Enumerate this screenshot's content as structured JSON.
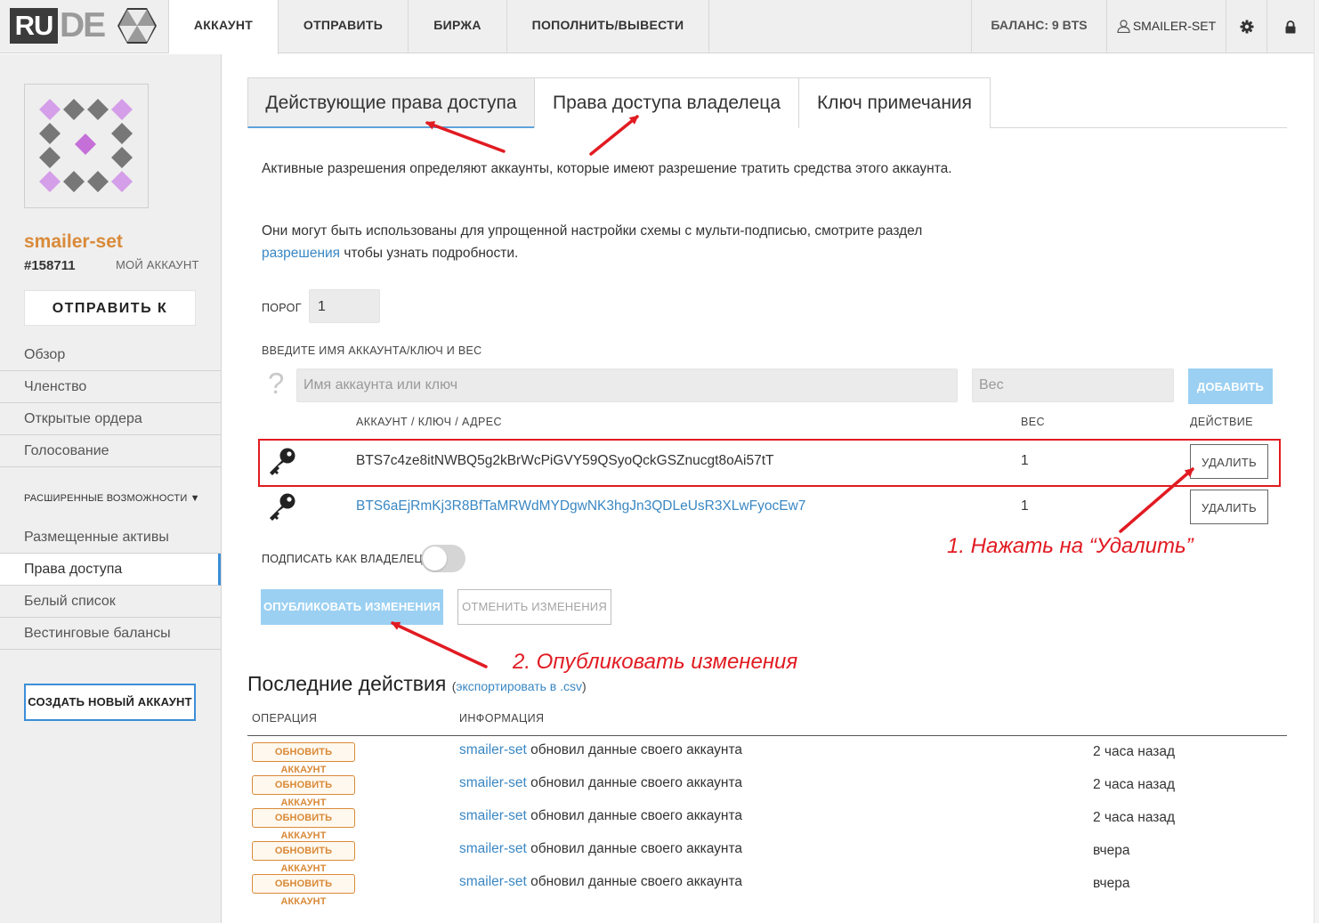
{
  "logo": {
    "part1": "RU",
    "part2": "DE"
  },
  "nav": [
    "АККАУНТ",
    "ОТПРАВИТЬ",
    "БИРЖА",
    "ПОПОЛНИТЬ/ВЫВЕСТИ"
  ],
  "header": {
    "balance": "БАЛАНС: 9 BTS",
    "user": "SMAILER-SET"
  },
  "icons": {
    "user": "user-icon",
    "settings": "gear-icon",
    "lock": "lock-icon",
    "key": "key-icon",
    "question": "question-mark-icon"
  },
  "colors": {
    "accent": "#3b8ed8",
    "account_name": "#d98a38",
    "link": "#3a87c3",
    "primary_button": "#9bd0f2",
    "annotation": "#e11b22"
  },
  "sidebar": {
    "account_name": "smailer-set",
    "account_id": "#158711",
    "my_account": "МОЙ АККАУНТ",
    "send_button": "ОТПРАВИТЬ К",
    "menu_top": [
      "Обзор",
      "Членство",
      "Открытые ордера",
      "Голосование"
    ],
    "advanced_label": "РАСШИРЕННЫЕ ВОЗМОЖНОСТИ ▼",
    "menu_advanced": [
      "Размещенные активы",
      "Права доступа",
      "Белый список",
      "Вестинговые балансы"
    ],
    "create_button": "СОЗДАТЬ НОВЫЙ АККАУНТ"
  },
  "tabs": [
    "Действующие права доступа",
    "Права доступа владелеца",
    "Ключ примечания"
  ],
  "content": {
    "para1": "Активные разрешения определяют аккаунты, которые имеют разрешение тратить средства этого аккаунта.",
    "para2_before": "Они могут быть использованы для упрощенной настройки схемы с мульти-подписью, смотрите раздел ",
    "para2_link": "разрешения",
    "para2_after": " чтобы узнать подробности.",
    "threshold_label": "ПОРОГ",
    "threshold_value": "1",
    "enter_label": "ВВЕДИТЕ ИМЯ АККАУНТА/КЛЮЧ И ВЕС",
    "name_placeholder": "Имя аккаунта или ключ",
    "weight_placeholder": "Вес",
    "add_button": "ДОБАВИТЬ",
    "columns": {
      "key": "АККАУНТ / КЛЮЧ / АДРЕС",
      "weight": "ВЕС",
      "action": "ДЕЙСТВИЕ"
    },
    "keys": [
      {
        "key": "BTS7c4ze8itNWBQ5g2kBrWcPiGVY59QSyoQckGSZnucgt8oAi57tT",
        "weight": "1",
        "action": "УДАЛИТЬ"
      },
      {
        "key": "BTS6aEjRmKj3R8BfTaMRWdMYDgwNK3hgJn3QDLeUsR3XLwFyocEw7",
        "weight": "1",
        "action": "УДАЛИТЬ"
      }
    ],
    "sign_label": "ПОДПИСАТЬ КАК ВЛАДЕЛЕЦ:",
    "publish_button": "ОПУБЛИКОВАТЬ ИЗМЕНЕНИЯ",
    "cancel_button": "ОТМЕНИТЬ ИЗМЕНЕНИЯ"
  },
  "recent": {
    "title": "Последние действия",
    "export_open": "(",
    "export_link": "экспортировать в .csv",
    "export_close": ")",
    "col_op": "ОПЕРАЦИЯ",
    "col_info": "ИНФОРМАЦИЯ",
    "rows": [
      {
        "op": "ОБНОВИТЬ АККАУНТ",
        "user": "smailer-set",
        "text": " обновил данные своего аккаунта",
        "when": "2 часа назад"
      },
      {
        "op": "ОБНОВИТЬ АККАУНТ",
        "user": "smailer-set",
        "text": " обновил данные своего аккаунта",
        "when": "2 часа назад"
      },
      {
        "op": "ОБНОВИТЬ АККАУНТ",
        "user": "smailer-set",
        "text": " обновил данные своего аккаунта",
        "when": "2 часа назад"
      },
      {
        "op": "ОБНОВИТЬ АККАУНТ",
        "user": "smailer-set",
        "text": " обновил данные своего аккаунта",
        "when": "вчера"
      },
      {
        "op": "ОБНОВИТЬ АККАУНТ",
        "user": "smailer-set",
        "text": " обновил данные своего аккаунта",
        "when": "вчера"
      }
    ]
  },
  "annotations": {
    "step1": "1. Нажать на “Удалить”",
    "step2": "2. Опубликовать изменения"
  }
}
